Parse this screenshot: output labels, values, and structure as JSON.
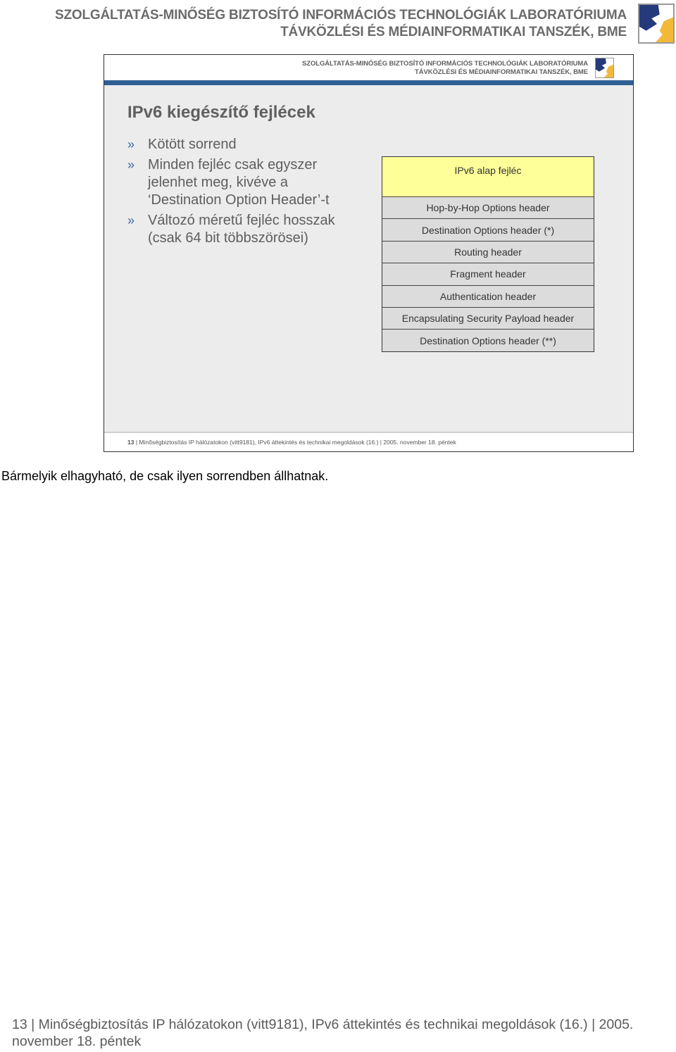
{
  "page_header": {
    "line1": "SZOLGÁLTATÁS-MINŐSÉG BIZTOSÍTÓ INFORMÁCIÓS TECHNOLÓGIÁK LABORATÓRIUMA",
    "line2": "TÁVKÖZLÉSI ÉS MÉDIAINFORMATIKAI TANSZÉK, BME",
    "logo_icon": "bme-lab-logo",
    "colors": {
      "logo_blue": "#243a7a",
      "logo_yellow": "#f2b838",
      "bar_blue": "#2f5f95"
    }
  },
  "slide": {
    "header": {
      "line1": "SZOLGÁLTATÁS-MINŐSÉG BIZTOSÍTÓ INFORMÁCIÓS TECHNOLÓGIÁK LABORATÓRIUMA",
      "line2": "TÁVKÖZLÉSI ÉS MÉDIAINFORMATIKAI TANSZÉK, BME"
    },
    "title": "IPv6 kiegészítő fejlécek",
    "bullet_mark": "»",
    "bullets": [
      {
        "text": "Kötött sorrend"
      },
      {
        "text": "Minden fejléc csak egyszer jelenhet meg, kivéve a ‘Destination Option Header’-t"
      },
      {
        "text": "Változó méretű fejléc hosszak (csak 64 bit többszörösei)"
      }
    ],
    "header_stack": [
      {
        "label": "IPv6 alap fejléc",
        "highlight": true
      },
      {
        "label": "Hop-by-Hop Options header"
      },
      {
        "label": "Destination Options header (*)"
      },
      {
        "label": "Routing header"
      },
      {
        "label": "Fragment header"
      },
      {
        "label": "Authentication header"
      },
      {
        "label": "Encapsulating Security Payload header"
      },
      {
        "label": "Destination Options header (**)"
      }
    ],
    "footer": {
      "page_number": "13",
      "text": "| Minőségbiztosítás IP hálózatokon (vitt9181), IPv6 áttekintés és technikai megoldások (16.) | 2005. november 18. péntek"
    }
  },
  "note": "Bármelyik elhagyható, de csak ilyen sorrendben állhatnak.",
  "page_footer": {
    "text": "13 | Minőségbiztosítás IP hálózatokon (vitt9181), IPv6 áttekintés és technikai megoldások (16.) | 2005. november 18. péntek"
  }
}
